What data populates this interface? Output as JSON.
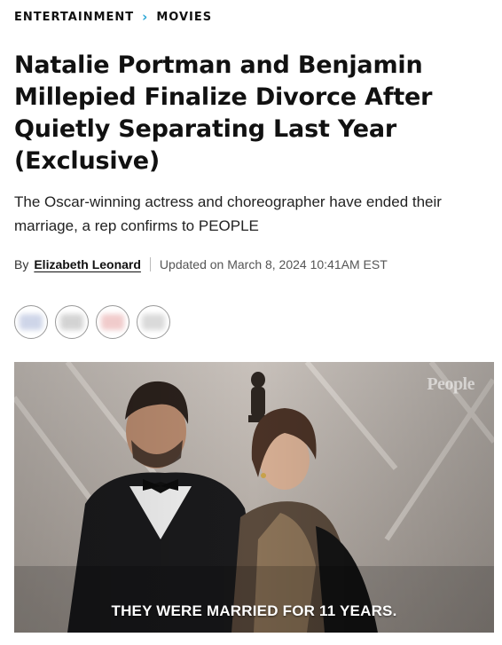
{
  "breadcrumb": {
    "section": "ENTERTAINMENT",
    "separator": "›",
    "subsection": "MOVIES"
  },
  "article": {
    "headline": "Natalie Portman and Benjamin Millepied Finalize Divorce After Quietly Separating Last Year (Exclusive)",
    "dek": "The Oscar-winning actress and choreographer have ended their marriage, a rep confirms to PEOPLE",
    "byline": {
      "prefix": "By",
      "author": "Elizabeth Leonard",
      "updated": "Updated on March 8, 2024 10:41AM EST"
    }
  },
  "share": {
    "buttons": [
      {
        "icon": "facebook-icon",
        "color": "#3b5998"
      },
      {
        "icon": "pinterest-icon",
        "color": "#222222"
      },
      {
        "icon": "flipboard-icon",
        "color": "#e12828"
      },
      {
        "icon": "email-icon",
        "color": "#555555"
      }
    ]
  },
  "hero": {
    "caption": "THEY WERE MARRIED FOR 11 YEARS.",
    "watermark": "People"
  },
  "colors": {
    "accent": "#2aa6d6",
    "text": "#111111"
  }
}
